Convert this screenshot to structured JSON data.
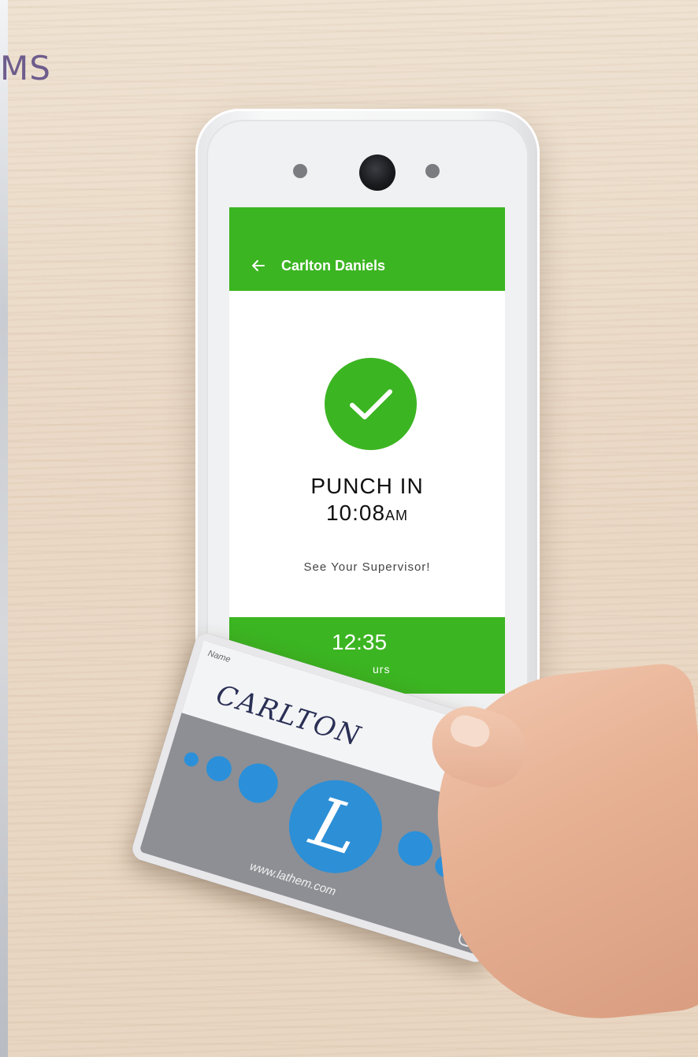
{
  "brand": {
    "text": "MS"
  },
  "screen": {
    "app_bar": {
      "title": "Carlton Daniels",
      "back_icon": "arrow-left-icon"
    },
    "status": {
      "icon": "check-circle-icon",
      "label": "PUNCH IN",
      "time": "10:08",
      "ampm": "AM",
      "message": "See Your Supervisor!"
    },
    "footer": {
      "hours_value": "12:35",
      "hours_label": "urs"
    },
    "colors": {
      "accent": "#3cb522",
      "background": "#ffffff"
    }
  },
  "card": {
    "name_label": "Name",
    "signature": "CARLTON",
    "logo_letter": "L",
    "url": "www.lathem.com",
    "colors": {
      "body": "#8e8f94",
      "accent": "#2b90d9"
    }
  }
}
